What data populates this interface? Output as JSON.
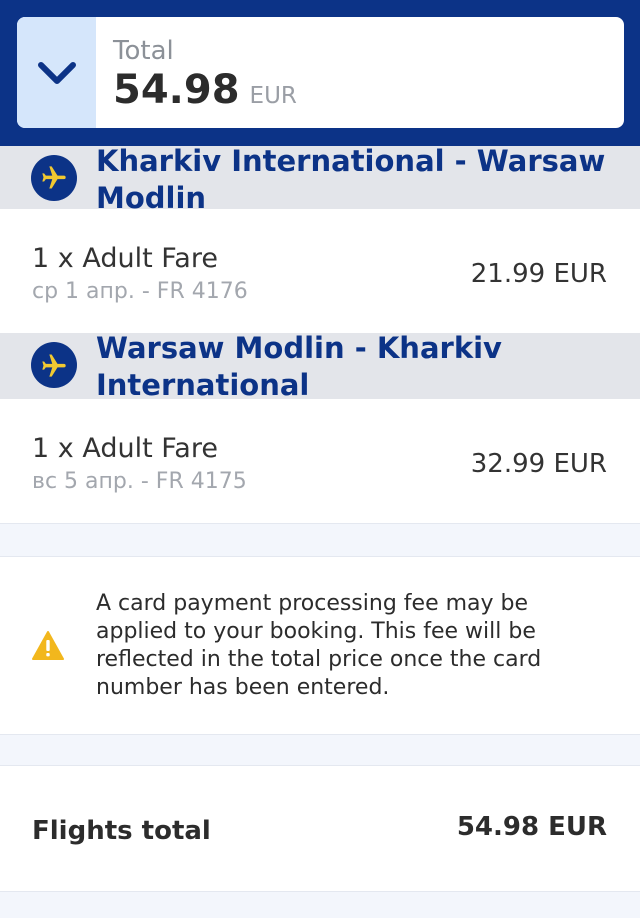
{
  "header": {
    "total_label": "Total",
    "total_amount": "54.98",
    "total_currency": "EUR"
  },
  "segments": [
    {
      "route": "Kharkiv International - Warsaw Modlin",
      "fare_label": "1 x Adult Fare",
      "fare_detail": "ср 1 апр. - FR 4176",
      "fare_price": "21.99 EUR"
    },
    {
      "route": "Warsaw Modlin - Kharkiv International",
      "fare_label": "1 x Adult Fare",
      "fare_detail": "вс 5 апр. - FR 4175",
      "fare_price": "32.99 EUR"
    }
  ],
  "notice": {
    "text": "A card payment processing fee may be applied to your booking. This fee will be reflected in the total price once the card number has been entered."
  },
  "summary": {
    "label": "Flights total",
    "value": "54.98 EUR"
  },
  "colors": {
    "brand_blue": "#0c3387",
    "warning_yellow": "#f2b71d",
    "accent_yellow": "#f1c931"
  },
  "icons": {
    "toggle": "chevron-down-icon",
    "route": "plane-icon",
    "notice": "warning-icon"
  }
}
